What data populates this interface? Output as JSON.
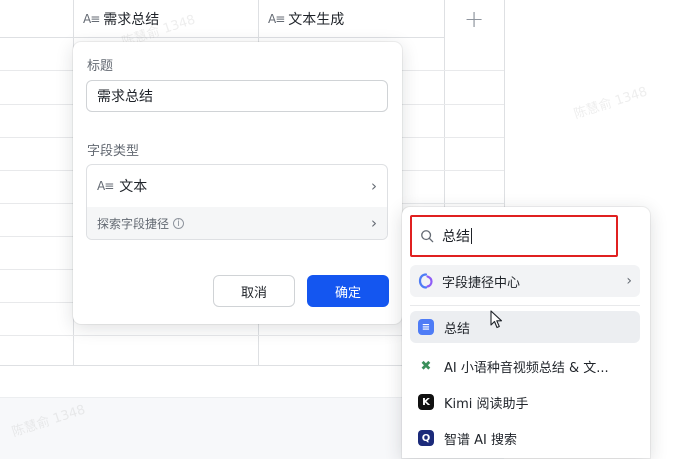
{
  "columns": [
    {
      "icon": "text-field-icon",
      "glyph": "A≡",
      "label": "需求总结"
    },
    {
      "icon": "text-field-icon",
      "glyph": "A≡",
      "label": "文本生成"
    }
  ],
  "add_column_label": "+",
  "popup": {
    "title_label": "标题",
    "title_value": "需求总结",
    "field_type_label": "字段类型",
    "field_type_glyph": "A≡",
    "field_type_value": "文本",
    "explore_label": "探索字段捷径",
    "info_glyph": "i",
    "chevron": "›",
    "cancel_label": "取消",
    "confirm_label": "确定"
  },
  "dropdown": {
    "search_value": "总结",
    "shortcut_center_label": "字段捷径中心",
    "items": [
      {
        "label": "总结",
        "icon": "summary-app-icon",
        "color": "#4e7cf6",
        "glyph": "≡"
      },
      {
        "label": "AI 小语种音视频总结 & 文...",
        "icon": "ai-multilingual-icon",
        "color": "#3a8f5a",
        "glyph": "✖"
      },
      {
        "label": "Kimi 阅读助手",
        "icon": "kimi-icon",
        "color": "#111111",
        "glyph": "K"
      },
      {
        "label": "智谱 AI 搜索",
        "icon": "zhipu-search-icon",
        "color": "#1b2a7a",
        "glyph": "Q"
      }
    ]
  },
  "colors": {
    "accent": "#1456f0",
    "highlight_border": "#e02020"
  },
  "watermark": "陈慧俞 1348"
}
